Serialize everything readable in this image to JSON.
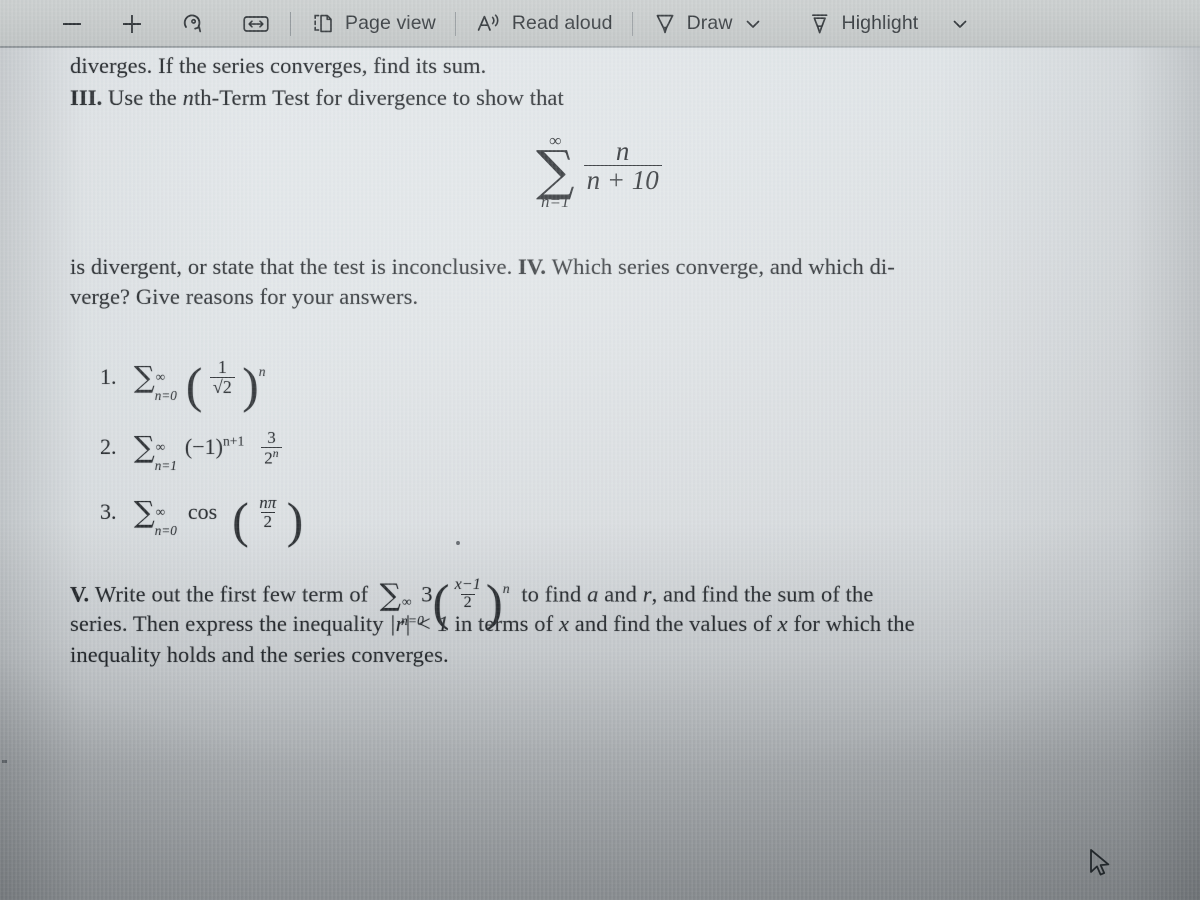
{
  "toolbar": {
    "zoom_out_label": "−",
    "zoom_out_icon": "minus-icon",
    "zoom_in_label": "+",
    "zoom_in_icon": "plus-icon",
    "rotate_icon": "rotate-clockwise-icon",
    "fit_width_icon": "fit-to-width-icon",
    "page_view_icon": "page-view-icon",
    "page_view_label": "Page view",
    "read_aloud_icon": "read-aloud-icon",
    "read_aloud_label": "Read aloud",
    "draw_icon": "draw-pen-icon",
    "draw_label": "Draw",
    "draw_chevron": "chevron-down-icon",
    "highlight_icon": "highlighter-icon",
    "highlight_label": "Highlight",
    "highlight_chevron": "chevron-down-icon"
  },
  "document": {
    "line1": "diverges. If the series converges, find its sum.",
    "line2_label": "III.",
    "line2": "Use the",
    "line2_italic": "n",
    "line2_rest": "th-Term Test for divergence to show that",
    "display_formula": {
      "sigma": "∑",
      "upper_limit": "∞",
      "lower_limit": "n=1",
      "numerator": "n",
      "denominator": "n + 10"
    },
    "line3_a": "is divergent, or state that the test is inconclusive.",
    "line3_label": "IV.",
    "line3_b": "Which series converge, and which di-",
    "line4": "verge? Give reasons for your answers.",
    "items": [
      {
        "number": "1.",
        "sigma": "∑",
        "upper_limit": "∞",
        "lower_limit": "n=0",
        "base_num": "1",
        "base_den": "√2",
        "exponent": "n"
      },
      {
        "number": "2.",
        "sigma": "∑",
        "upper_limit": "∞",
        "lower_limit": "n=1",
        "factor": "(−1)",
        "factor_exponent": "n+1",
        "frac_num": "3",
        "frac_den": "2",
        "frac_den_exponent": "n"
      },
      {
        "number": "3.",
        "sigma": "∑",
        "upper_limit": "∞",
        "lower_limit": "n=0",
        "function": "cos",
        "arg_num": "nπ",
        "arg_den": "2"
      }
    ],
    "paragraph_v": {
      "label": "V.",
      "text_a": "Write out the first few term of",
      "sigma": "∑",
      "upper_limit": "∞",
      "lower_limit": "n=0",
      "coefficient": "3",
      "frac_num": "x−1",
      "frac_den": "2",
      "exponent": "n",
      "text_b": "to find",
      "var_a": "a",
      "text_c": "and",
      "var_r": "r",
      "text_d": ", and find the sum of the",
      "line2_a": "series. Then express the inequality",
      "line2_ineq": "|r| < 1",
      "line2_b": "in terms of",
      "line2_x1": "x",
      "line2_c": "and find the values of",
      "line2_x2": "x",
      "line2_d": "for which the",
      "line3": "inequality holds and the series converges."
    }
  },
  "cursor": {
    "icon": "mouse-pointer-icon"
  },
  "colors": {
    "toolbar_bg": "#c3c7c7",
    "page_bg": "#dde2e5",
    "ink": "#1c2024",
    "shadow": "#2a2e32"
  }
}
